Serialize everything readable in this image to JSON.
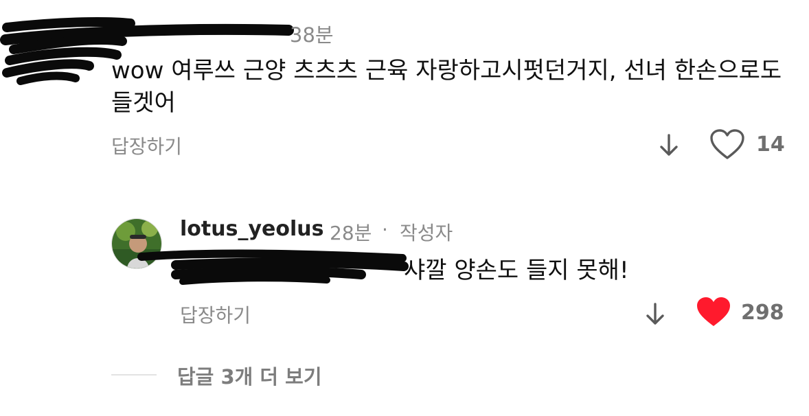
{
  "comment1": {
    "time": "38분",
    "text": "wow 여루쓰 근양 츠츠츠 근육 자랑하고시펏던거지, 선녀 한손으로도 들겟어",
    "reply_label": "답장하기",
    "like_count": "14",
    "liked": false
  },
  "comment2": {
    "username": "lotus_yeolus",
    "time": "28분",
    "separator": "·",
    "author_badge": "작성자",
    "text": "샤깔 양손도 들지 못해!",
    "reply_label": "답장하기",
    "like_count": "298",
    "liked": true
  },
  "more_replies_label": "답글 3개 더 보기",
  "colors": {
    "like_red": "#ff1a2d",
    "muted_text": "#8a8a8a",
    "redaction": "#0a0a0a"
  },
  "icons": {
    "down": "arrow-down-icon",
    "heart_outline": "heart-outline-icon",
    "heart_filled": "heart-filled-icon"
  }
}
